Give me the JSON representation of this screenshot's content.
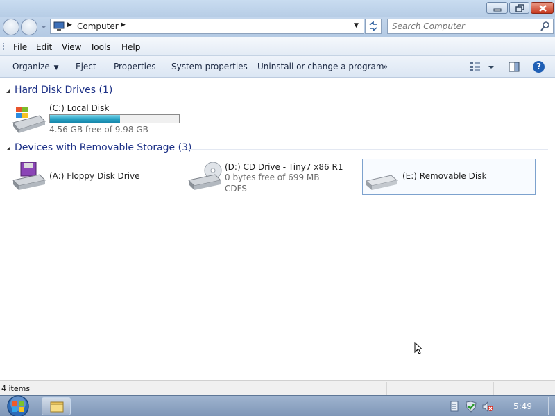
{
  "window": {
    "title": "Computer"
  },
  "address": {
    "location": "Computer",
    "search_placeholder": "Search Computer"
  },
  "menu": [
    "File",
    "Edit",
    "View",
    "Tools",
    "Help"
  ],
  "commands": {
    "organize": "Organize",
    "eject": "Eject",
    "properties": "Properties",
    "system_properties": "System properties",
    "uninstall": "Uninstall or change a program",
    "more": "»"
  },
  "groups": {
    "hard_disk": {
      "title": "Hard Disk Drives (1)"
    },
    "removable": {
      "title": "Devices with Removable Storage (3)"
    }
  },
  "drives": {
    "c": {
      "name": "(C:) Local Disk",
      "free": "4.56 GB free of 9.98 GB",
      "used_fraction": 0.543
    },
    "a": {
      "name": "(A:) Floppy Disk Drive"
    },
    "d": {
      "name": "(D:) CD Drive - Tiny7 x86 R1",
      "free": "0 bytes free of 699 MB",
      "fs": "CDFS"
    },
    "e": {
      "name": "(E:) Removable Disk"
    }
  },
  "status": {
    "items": "4 items"
  },
  "taskbar": {
    "clock": "5:49"
  },
  "colors": {
    "group_title": "#1e3287",
    "progress_fill": "#2aa3c4",
    "selection_border": "#7da2ce"
  }
}
